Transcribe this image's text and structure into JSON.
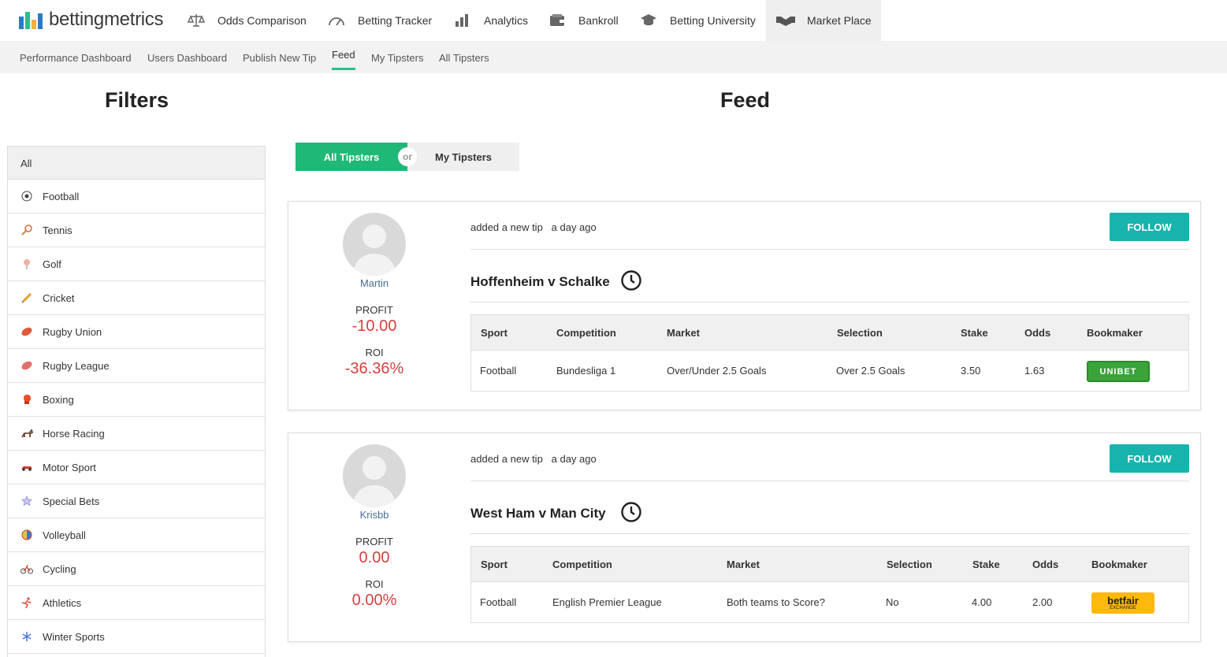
{
  "brand": {
    "name": "bettingmetrics"
  },
  "nav": [
    {
      "label": "Odds Comparison",
      "icon": "scales-icon"
    },
    {
      "label": "Betting Tracker",
      "icon": "gauge-icon"
    },
    {
      "label": "Analytics",
      "icon": "bar-chart-icon"
    },
    {
      "label": "Bankroll",
      "icon": "wallet-icon"
    },
    {
      "label": "Betting University",
      "icon": "graduation-cap-icon"
    },
    {
      "label": "Market Place",
      "icon": "handshake-icon"
    }
  ],
  "subnav": [
    "Performance Dashboard",
    "Users Dashboard",
    "Publish New Tip",
    "Feed",
    "My Tipsters",
    "All Tipsters"
  ],
  "headings": {
    "filters": "Filters",
    "feed": "Feed"
  },
  "sidebar": {
    "all": "All",
    "items": [
      {
        "label": "Football",
        "icon": "football-icon"
      },
      {
        "label": "Tennis",
        "icon": "tennis-racket-icon"
      },
      {
        "label": "Golf",
        "icon": "golf-tee-icon"
      },
      {
        "label": "Cricket",
        "icon": "cricket-bat-icon"
      },
      {
        "label": "Rugby Union",
        "icon": "rugby-ball-icon"
      },
      {
        "label": "Rugby League",
        "icon": "rugby-ball-icon"
      },
      {
        "label": "Boxing",
        "icon": "boxing-glove-icon"
      },
      {
        "label": "Horse Racing",
        "icon": "horse-icon"
      },
      {
        "label": "Motor Sport",
        "icon": "race-car-icon"
      },
      {
        "label": "Special Bets",
        "icon": "star-icon"
      },
      {
        "label": "Volleyball",
        "icon": "volleyball-icon"
      },
      {
        "label": "Cycling",
        "icon": "cyclist-icon"
      },
      {
        "label": "Athletics",
        "icon": "runner-icon"
      },
      {
        "label": "Winter Sports",
        "icon": "snowflake-icon"
      }
    ]
  },
  "toggle": {
    "left": "All Tipsters",
    "or": "or",
    "right": "My Tipsters"
  },
  "labels": {
    "profit": "PROFIT",
    "roi": "ROI",
    "follow": "FOLLOW",
    "added": "added a new tip",
    "when": "a day ago"
  },
  "table_headers": [
    "Sport",
    "Competition",
    "Market",
    "Selection",
    "Stake",
    "Odds",
    "Bookmaker"
  ],
  "tips": [
    {
      "user": "Martin",
      "profit": "-10.00",
      "roi": "-36.36%",
      "match": "Hoffenheim v Schalke",
      "row": [
        "Football",
        "Bundesliga 1",
        "Over/Under 2.5 Goals",
        "Over 2.5 Goals",
        "3.50",
        "1.63"
      ],
      "bookmaker": {
        "name": "UNIBET",
        "color": "#3aa33a"
      }
    },
    {
      "user": "Krisbb",
      "profit": "0.00",
      "roi": "0.00%",
      "match": "West Ham v Man City",
      "row": [
        "Football",
        "English Premier League",
        "Both teams to Score?",
        "No",
        "4.00",
        "2.00"
      ],
      "bookmaker": {
        "name": "betfair",
        "sub": "EXCHANGE",
        "color": "#ffb80c"
      }
    }
  ],
  "colors": {
    "accent_green": "#20b877",
    "follow_teal": "#17b3ad",
    "negative_red": "#d43f3f"
  }
}
